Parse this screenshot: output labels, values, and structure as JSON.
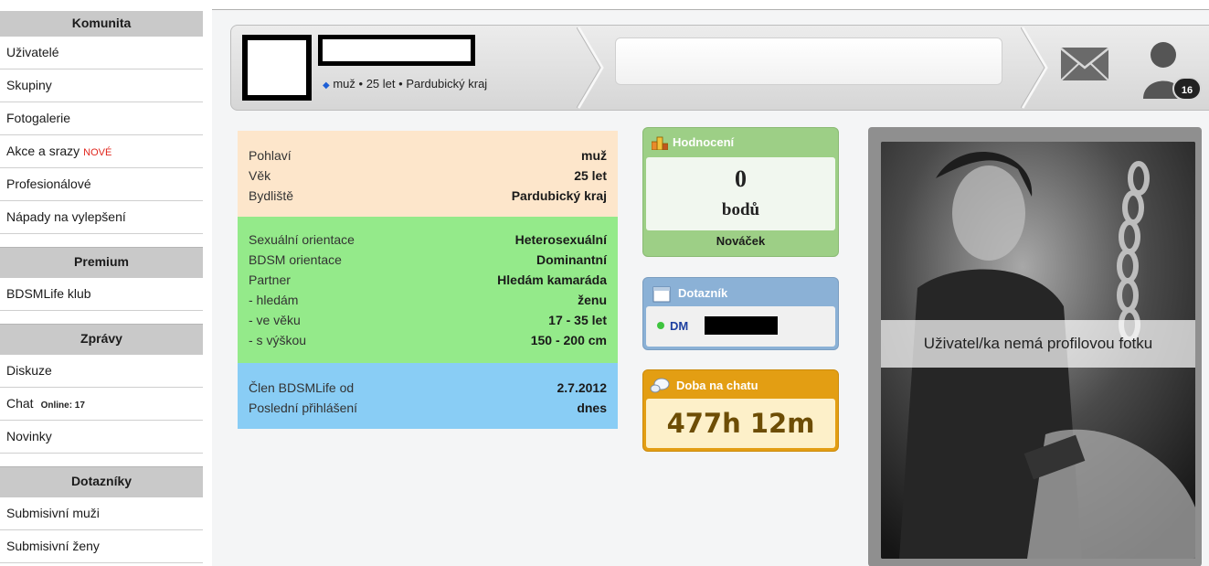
{
  "sidebar": {
    "sections": [
      {
        "title": "Komunita",
        "items": [
          {
            "label": "Uživatelé"
          },
          {
            "label": "Skupiny"
          },
          {
            "label": "Fotogalerie"
          },
          {
            "label": "Akce a srazy",
            "badge": "NOVÉ"
          },
          {
            "label": "Profesionálové"
          },
          {
            "label": "Nápady na vylepšení"
          }
        ]
      },
      {
        "title": "Premium",
        "items": [
          {
            "label": "BDSMLife klub"
          }
        ]
      },
      {
        "title": "Zprávy",
        "items": [
          {
            "label": "Diskuze"
          },
          {
            "label": "Chat",
            "online": "Online: 17"
          },
          {
            "label": "Novinky"
          }
        ]
      },
      {
        "title": "Dotazníky",
        "items": [
          {
            "label": "Submisivní muži"
          },
          {
            "label": "Submisivní ženy"
          }
        ]
      }
    ]
  },
  "header": {
    "gender": "muž",
    "age": "25 let",
    "region": "Pardubický kraj",
    "separator": "•",
    "notification_count": "16",
    "icons": {
      "mail": "envelope-icon",
      "user": "user-silhouette-icon"
    }
  },
  "profile": {
    "basic": [
      {
        "key": "Pohlaví",
        "value": "muž"
      },
      {
        "key": "Věk",
        "value": "25 let"
      },
      {
        "key": "Bydliště",
        "value": "Pardubický kraj"
      }
    ],
    "orientation": [
      {
        "key": "Sexuální orientace",
        "value": "Heterosexuální"
      },
      {
        "key": "BDSM orientace",
        "value": "Dominantní"
      },
      {
        "key": "Partner",
        "value": "Hledám kamaráda"
      },
      {
        "key": "- hledám",
        "value": "ženu"
      },
      {
        "key": "- ve věku",
        "value": "17 - 35 let"
      },
      {
        "key": "- s výškou",
        "value": "150 - 200 cm"
      }
    ],
    "membership": [
      {
        "key": "Člen BDSMLife od",
        "value": "2.7.2012"
      },
      {
        "key": "Poslední přihlášení",
        "value": "dnes"
      }
    ]
  },
  "widgets": {
    "rating": {
      "title": "Hodnocení",
      "points": "0",
      "points_label": "bodů",
      "level": "Nováček"
    },
    "quiz": {
      "title": "Dotazník",
      "entry_prefix": "DM"
    },
    "chat_time": {
      "title": "Doba na chatu",
      "value": "477h 12m"
    }
  },
  "photo": {
    "note": "Uživatel/ka nemá profilovou fotku"
  },
  "colors": {
    "basic_bg": "#fde6cb",
    "orientation_bg": "#94ea8a",
    "membership_bg": "#89cdf5",
    "rating_green": "#9dcf86",
    "quiz_blue": "#8bb1d6",
    "chat_orange": "#e39e13",
    "new_badge_red": "#e0261d"
  }
}
